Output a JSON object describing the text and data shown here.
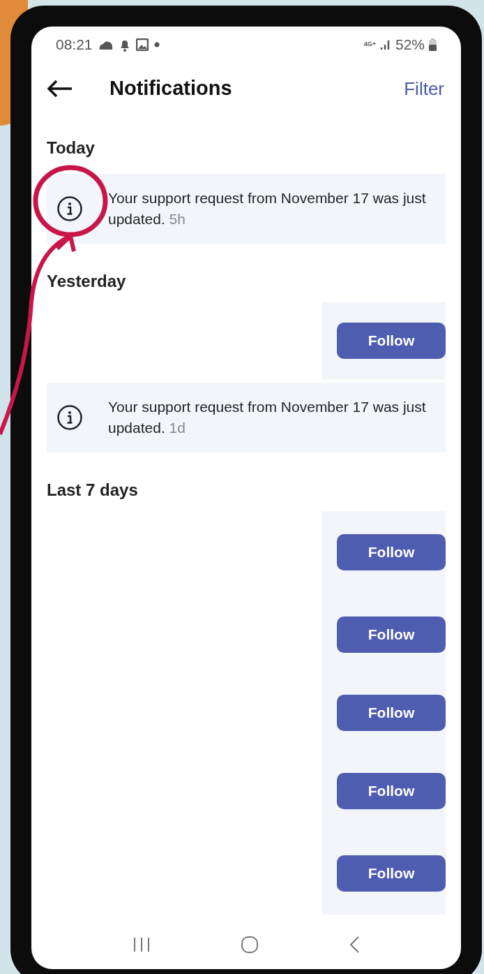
{
  "status_bar": {
    "time": "08:21",
    "network": "4G+",
    "battery": "52%"
  },
  "header": {
    "title": "Notifications",
    "action": "Filter"
  },
  "sections": [
    {
      "title": "Today",
      "items": [
        {
          "kind": "info",
          "text": "Your support request from November 17 was just updated.",
          "time": "5h"
        }
      ]
    },
    {
      "title": "Yesterday",
      "items": [
        {
          "kind": "follow",
          "button": "Follow"
        },
        {
          "kind": "info",
          "text": "Your support request from November 17 was just updated.",
          "time": "1d"
        }
      ]
    },
    {
      "title": "Last 7 days",
      "items": [
        {
          "kind": "follow",
          "button": "Follow"
        },
        {
          "kind": "follow",
          "button": "Follow"
        },
        {
          "kind": "follow",
          "button": "Follow"
        },
        {
          "kind": "follow",
          "button": "Follow"
        },
        {
          "kind": "follow",
          "button": "Follow"
        }
      ]
    }
  ]
}
